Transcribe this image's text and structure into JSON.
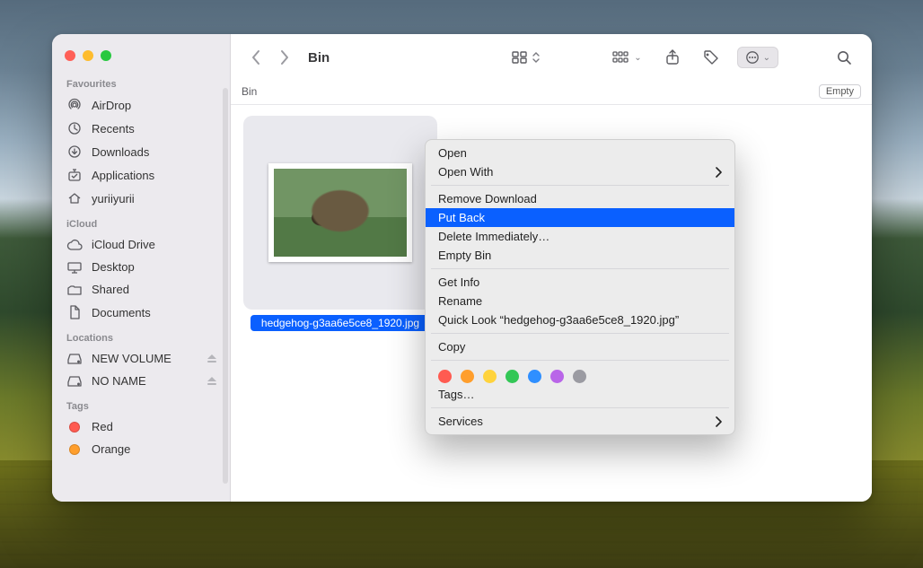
{
  "window": {
    "title": "Bin"
  },
  "path": {
    "crumb": "Bin",
    "empty_label": "Empty"
  },
  "sidebar": {
    "sections": [
      {
        "title": "Favourites",
        "items": [
          {
            "icon": "airdrop",
            "label": "AirDrop"
          },
          {
            "icon": "clock",
            "label": "Recents"
          },
          {
            "icon": "download",
            "label": "Downloads"
          },
          {
            "icon": "apps",
            "label": "Applications"
          },
          {
            "icon": "home",
            "label": "yuriiyurii"
          }
        ]
      },
      {
        "title": "iCloud",
        "items": [
          {
            "icon": "cloud",
            "label": "iCloud Drive"
          },
          {
            "icon": "desktop",
            "label": "Desktop"
          },
          {
            "icon": "shared",
            "label": "Shared"
          },
          {
            "icon": "doc",
            "label": "Documents"
          }
        ]
      },
      {
        "title": "Locations",
        "items": [
          {
            "icon": "disk",
            "label": "NEW VOLUME",
            "eject": true
          },
          {
            "icon": "disk",
            "label": "NO NAME",
            "eject": true
          }
        ]
      },
      {
        "title": "Tags",
        "items": [
          {
            "icon": "tagdot",
            "color": "#ff5b51",
            "label": "Red"
          },
          {
            "icon": "tagdot",
            "color": "#ff9e2c",
            "label": "Orange"
          }
        ]
      }
    ]
  },
  "file": {
    "name": "hedgehog-g3aa6e5ce8_1920.jpg"
  },
  "context_menu": {
    "groups": [
      [
        {
          "label": "Open"
        },
        {
          "label": "Open With",
          "submenu": true
        }
      ],
      [
        {
          "label": "Remove Download"
        },
        {
          "label": "Put Back",
          "highlight": true
        },
        {
          "label": "Delete Immediately…"
        },
        {
          "label": "Empty Bin"
        }
      ],
      [
        {
          "label": "Get Info"
        },
        {
          "label": "Rename"
        },
        {
          "label": "Quick Look “hedgehog-g3aa6e5ce8_1920.jpg”"
        }
      ],
      [
        {
          "label": "Copy"
        }
      ]
    ],
    "tag_colors": [
      "#ff5b51",
      "#ff9e2c",
      "#ffd33c",
      "#33c756",
      "#2f8fff",
      "#b965e8",
      "#9b9ba2"
    ],
    "tags_label": "Tags…",
    "services_label": "Services"
  }
}
